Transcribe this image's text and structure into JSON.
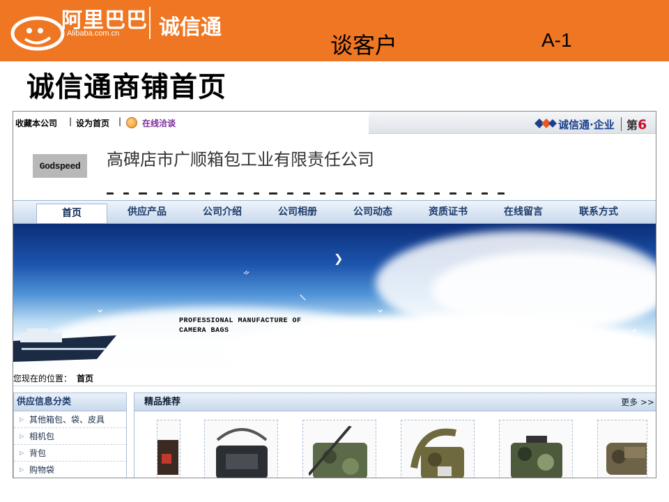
{
  "slide": {
    "logo_cn": "阿里巴巴",
    "logo_en": "Alibaba.com.cn",
    "brand": "诚信通",
    "title": "谈客户",
    "code": "A-1",
    "heading": "诚信通商铺首页"
  },
  "colors": {
    "slide_bar": "#ef7622",
    "nav_text": "#1b3a6b",
    "chat_text": "#7a2c9a",
    "rank_accent": "#c8102e"
  },
  "topbar": {
    "bookmark": "收藏本公司",
    "homepage": "设为首页",
    "chat": "在线洽谈",
    "chat_icon": "smiley-chat-icon",
    "cxt_brand": "诚信通·企业",
    "cxt_rank_prefix": "第",
    "cxt_rank_num": "6"
  },
  "company": {
    "logo_text": "Godspeed",
    "name": "高碑店市广顺箱包工业有限责任公司"
  },
  "nav": {
    "items": [
      "首页",
      "供应产品",
      "公司介绍",
      "公司相册",
      "公司动态",
      "资质证书",
      "在线留言",
      "联系方式"
    ],
    "active": "首页"
  },
  "banner": {
    "line1": "PROFESSIONAL MANUFACTURE OF",
    "line2": "CAMERA BAGS"
  },
  "breadcrumb": {
    "label": "您现在的位置：",
    "current": "首页"
  },
  "sidebar": {
    "title": "供应信息分类",
    "items": [
      "其他箱包、袋、皮具",
      "相机包",
      "背包",
      "购物袋"
    ]
  },
  "featured": {
    "title": "精品推荐",
    "more": "更多 >>"
  }
}
